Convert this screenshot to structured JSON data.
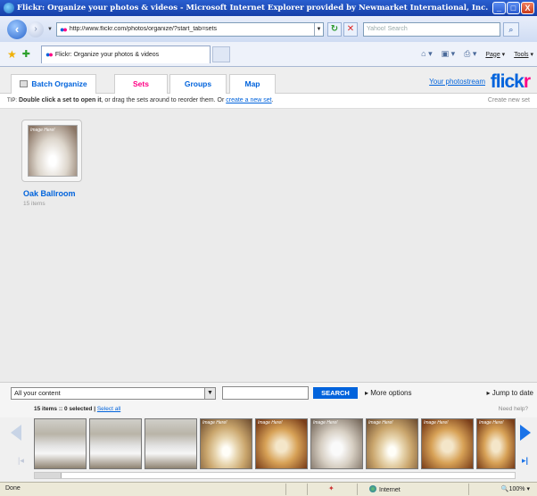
{
  "window": {
    "title": "Flickr: Organize your photos & videos - Microsoft Internet Explorer provided by Newmarket International, Inc.",
    "minimize_label": "_",
    "maximize_label": "□",
    "close_label": "X"
  },
  "address": {
    "url": "http://www.flickr.com/photos/organize/?start_tab=sets",
    "search_placeholder": "Yahoo! Search"
  },
  "browser_tab": {
    "label": "Flickr: Organize your photos & videos"
  },
  "command_bar": {
    "page_label": "Page",
    "tools_label": "Tools"
  },
  "flickr": {
    "tabs": [
      {
        "label": "Batch Organize",
        "active": false
      },
      {
        "label": "Sets",
        "active": true
      },
      {
        "label": "Groups",
        "active": false
      },
      {
        "label": "Map",
        "active": false
      }
    ],
    "photostream_link": "Your photostream",
    "logo_part1": "flick",
    "logo_part2": "r",
    "tip": {
      "label": "TIP:",
      "bold": "Double click a set to open it",
      "rest": ", or drag the sets around to reorder them. Or ",
      "link": "create a new set",
      "end": "."
    },
    "create_new_set": "Create new set",
    "sets": [
      {
        "name": "Oak Ballroom",
        "count": "15 items",
        "thumb_label": "Image Here!"
      }
    ]
  },
  "filter": {
    "content_select": "All your content",
    "search_button": "SEARCH",
    "more_options": "▸ More options",
    "jump_to_date": "▸ Jump to date"
  },
  "filmstrip": {
    "count_text": "15 items  :: 0 selected | ",
    "select_all": "Select all",
    "need_help": "Need help?",
    "thumb_label": "Image Here!"
  },
  "status": {
    "left": "Done",
    "zone": "Internet",
    "zoom": "100%"
  },
  "colors": {
    "flickr_blue": "#0063dc",
    "flickr_pink": "#ff0084"
  }
}
